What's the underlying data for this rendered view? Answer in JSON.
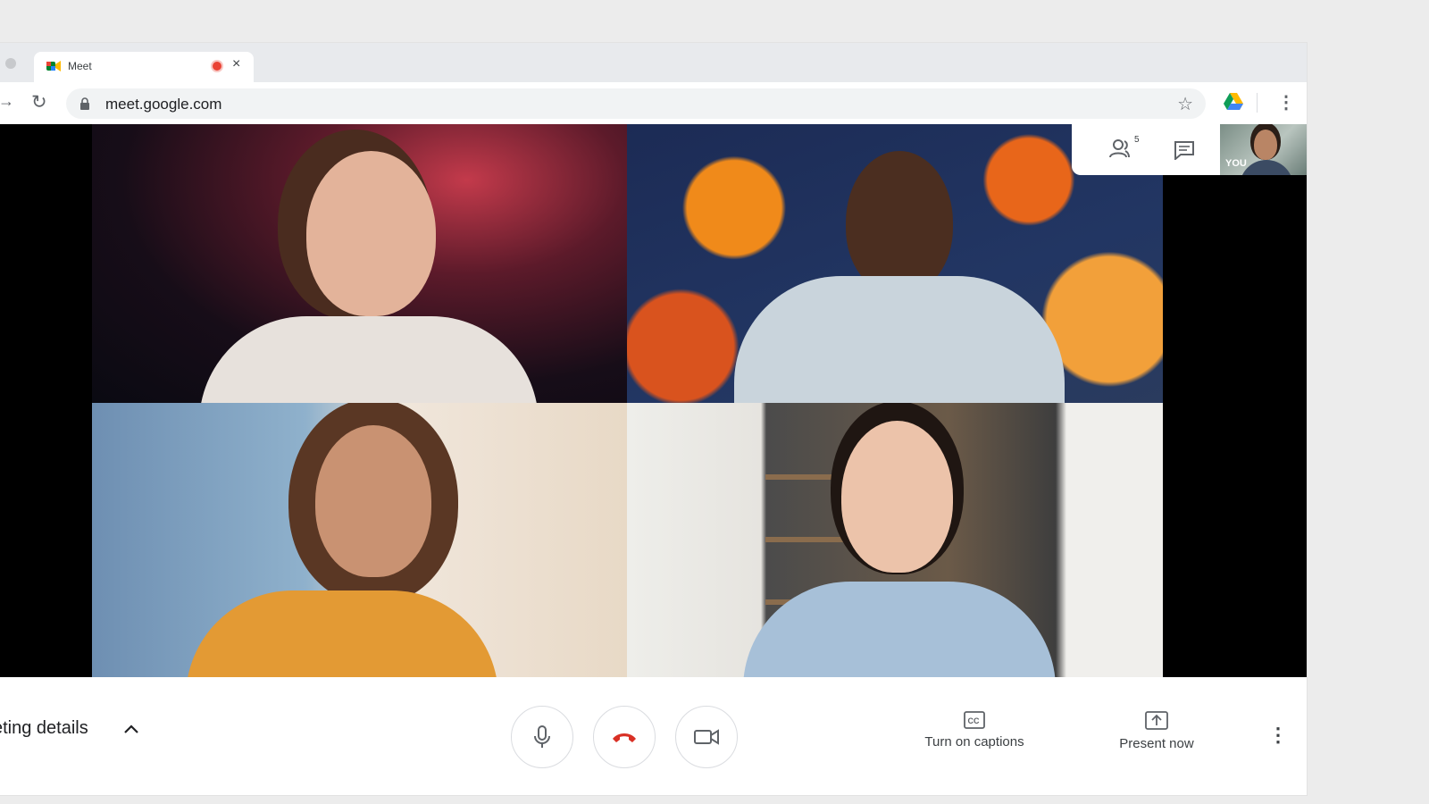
{
  "browser": {
    "tab": {
      "title": "Meet",
      "favicon": "meet-logo-icon",
      "recording": true,
      "close": "×"
    },
    "nav": {
      "forward": "forward-arrow-icon",
      "reload": "reload-icon"
    },
    "omnibox": {
      "url": "meet.google.com",
      "lock": "lock-icon",
      "bookmark": "star-icon"
    },
    "extensions": [
      "google-drive-icon"
    ],
    "menu": "⋮"
  },
  "meet": {
    "overlay": {
      "participants_count": "5",
      "participants_icon": "people-icon",
      "chat_icon": "chat-icon"
    },
    "self_view_label": "YOU",
    "tiles": [
      {
        "background": "nebula-space",
        "person": "woman-laughing"
      },
      {
        "background": "autumn-leaves",
        "person": "man-smiling-glasses"
      },
      {
        "background": "seaside-villa",
        "person": "woman-curly-hair"
      },
      {
        "background": "bookshelf-room",
        "person": "woman-glasses-talking"
      }
    ],
    "bottom": {
      "meeting_details": "eting details",
      "controls": {
        "mic": "microphone-icon",
        "hangup": "hang-up-icon",
        "camera": "camera-icon"
      },
      "captions_label": "Turn on captions",
      "present_label": "Present now",
      "more": "⋮"
    }
  },
  "colors": {
    "hangup": "#d93025",
    "record": "#ea4335",
    "icon": "#5f6368",
    "text": "#202124"
  }
}
